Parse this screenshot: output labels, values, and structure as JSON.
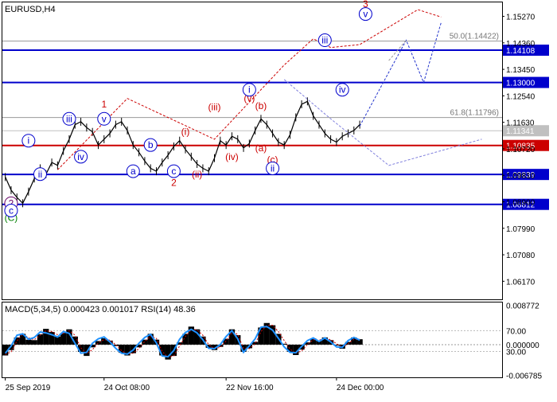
{
  "symbol": "EURUSD,H4",
  "chart_data": {
    "type": "candlestick",
    "main": {
      "ylim": [
        1.0555,
        1.1575
      ],
      "price_ticks": [
        "1.15270",
        "1.14360",
        "1.13450",
        "1.12540",
        "1.11630",
        "1.10720",
        "1.09810",
        "1.08900",
        "1.07990",
        "1.07080",
        "1.06170"
      ],
      "hlines": [
        {
          "value": 1.14108,
          "label": "1.14108",
          "color": "#0000cc"
        },
        {
          "value": 1.13,
          "label": "1.13000",
          "color": "#0000cc"
        },
        {
          "value": 1.10835,
          "label": "1.10835",
          "color": "#cc0000"
        },
        {
          "value": 1.09839,
          "label": "1.09839",
          "color": "#0000cc"
        },
        {
          "value": 1.08812,
          "label": "1.08812",
          "color": "#0000cc"
        }
      ],
      "current_price": "1.11341",
      "fib_levels": [
        {
          "value": 1.14422,
          "text": "50.0(1.14422)"
        },
        {
          "value": 1.11796,
          "text": "61.8(1.11796)"
        }
      ],
      "price_path": [
        [
          0,
          1.0975
        ],
        [
          1,
          1.093
        ],
        [
          2,
          1.0905
        ],
        [
          3,
          1.0885
        ],
        [
          4,
          1.0925
        ],
        [
          5,
          1.097
        ],
        [
          6,
          1.1005
        ],
        [
          7,
          1.0985
        ],
        [
          8,
          1.1025
        ],
        [
          9,
          1.1015
        ],
        [
          10,
          1.1065
        ],
        [
          11,
          1.1105
        ],
        [
          12,
          1.1155
        ],
        [
          13,
          1.1165
        ],
        [
          14,
          1.1145
        ],
        [
          15,
          1.113
        ],
        [
          16,
          1.1085
        ],
        [
          17,
          1.1105
        ],
        [
          18,
          1.1125
        ],
        [
          19,
          1.1155
        ],
        [
          20,
          1.1165
        ],
        [
          21,
          1.1135
        ],
        [
          22,
          1.1085
        ],
        [
          23,
          1.106
        ],
        [
          24,
          1.103
        ],
        [
          25,
          1.1005
        ],
        [
          26,
          1.0995
        ],
        [
          27,
          1.1025
        ],
        [
          28,
          1.105
        ],
        [
          29,
          1.108
        ],
        [
          30,
          1.11
        ],
        [
          31,
          1.107
        ],
        [
          32,
          1.1045
        ],
        [
          33,
          1.102
        ],
        [
          34,
          1.1005
        ],
        [
          35,
          1.0995
        ],
        [
          36,
          1.104
        ],
        [
          37,
          1.11
        ],
        [
          38,
          1.1085
        ],
        [
          39,
          1.1115
        ],
        [
          40,
          1.1105
        ],
        [
          41,
          1.1075
        ],
        [
          42,
          1.109
        ],
        [
          43,
          1.1135
        ],
        [
          44,
          1.1175
        ],
        [
          45,
          1.1155
        ],
        [
          46,
          1.1125
        ],
        [
          47,
          1.1095
        ],
        [
          48,
          1.1085
        ],
        [
          49,
          1.112
        ],
        [
          50,
          1.118
        ],
        [
          51,
          1.1225
        ],
        [
          52,
          1.1235
        ],
        [
          53,
          1.1185
        ],
        [
          54,
          1.1155
        ],
        [
          55,
          1.1125
        ],
        [
          56,
          1.1105
        ],
        [
          57,
          1.1095
        ],
        [
          58,
          1.1115
        ],
        [
          59,
          1.1125
        ],
        [
          60,
          1.1135
        ],
        [
          61,
          1.1155
        ]
      ],
      "zigzags": [
        {
          "color": "#cc0000",
          "points": [
            [
              9,
              1.1
            ],
            [
              21,
              1.1245
            ],
            [
              36,
              1.1105
            ],
            [
              48,
              1.136
            ],
            [
              53,
              1.145
            ],
            [
              56,
              1.142
            ],
            [
              61,
              1.143
            ],
            [
              71,
              1.155
            ],
            [
              75,
              1.1525
            ]
          ]
        },
        {
          "color": "#2233cc",
          "points": [
            [
              61,
              1.115
            ],
            [
              66,
              1.1335
            ],
            [
              69,
              1.1445
            ],
            [
              72,
              1.13
            ],
            [
              75,
              1.1505
            ]
          ]
        },
        {
          "color": "#999999",
          "points": [
            [
              66,
              1.1375
            ],
            [
              69,
              1.1445
            ]
          ]
        },
        {
          "color": "#7f7fdd",
          "points": [
            [
              48,
              1.131
            ],
            [
              56,
              1.1175
            ],
            [
              66,
              1.1015
            ],
            [
              82,
              1.1105
            ]
          ]
        }
      ],
      "wave_labels": [
        {
          "text": "(C)",
          "bar": 1,
          "value": 1.0835,
          "style": "paren",
          "color": "#008000"
        },
        {
          "text": "2",
          "bar": 1,
          "value": 1.0885,
          "style": "circle",
          "color": "#660066"
        },
        {
          "text": "c",
          "bar": 1,
          "value": 1.086,
          "style": "circle",
          "color": "#0000cc"
        },
        {
          "text": "i",
          "bar": 4,
          "value": 1.11,
          "style": "circle",
          "color": "#0000cc"
        },
        {
          "text": "ii",
          "bar": 6,
          "value": 1.0985,
          "style": "circle",
          "color": "#0000cc"
        },
        {
          "text": "iii",
          "bar": 11,
          "value": 1.1175,
          "style": "circle",
          "color": "#0000cc"
        },
        {
          "text": "iv",
          "bar": 13,
          "value": 1.1045,
          "style": "circle",
          "color": "#0000cc"
        },
        {
          "text": "v",
          "bar": 17,
          "value": 1.1175,
          "style": "circle",
          "color": "#0000cc"
        },
        {
          "text": "1",
          "bar": 17,
          "value": 1.1225,
          "style": "plain",
          "color": "#cc0000"
        },
        {
          "text": "a",
          "bar": 22,
          "value": 1.0995,
          "style": "circle",
          "color": "#0000cc"
        },
        {
          "text": "b",
          "bar": 25,
          "value": 1.1085,
          "style": "circle",
          "color": "#0000cc"
        },
        {
          "text": "c",
          "bar": 29,
          "value": 1.0995,
          "style": "circle",
          "color": "#0000cc"
        },
        {
          "text": "2",
          "bar": 29,
          "value": 1.0955,
          "style": "plain",
          "color": "#cc0000"
        },
        {
          "text": "(i)",
          "bar": 31,
          "value": 1.113,
          "style": "paren",
          "color": "#cc0000"
        },
        {
          "text": "(ii)",
          "bar": 33,
          "value": 1.0985,
          "style": "paren",
          "color": "#cc0000"
        },
        {
          "text": "(iii)",
          "bar": 36,
          "value": 1.1215,
          "style": "paren",
          "color": "#cc0000"
        },
        {
          "text": "(iv)",
          "bar": 39,
          "value": 1.1045,
          "style": "paren",
          "color": "#cc0000"
        },
        {
          "text": "(v)",
          "bar": 42,
          "value": 1.1245,
          "style": "paren",
          "color": "#cc0000"
        },
        {
          "text": "i",
          "bar": 42,
          "value": 1.1275,
          "style": "circle",
          "color": "#0000cc"
        },
        {
          "text": "(b)",
          "bar": 44,
          "value": 1.122,
          "style": "paren",
          "color": "#cc0000"
        },
        {
          "text": "(a)",
          "bar": 44,
          "value": 1.1075,
          "style": "paren",
          "color": "#cc0000"
        },
        {
          "text": "(c)",
          "bar": 46,
          "value": 1.1035,
          "style": "paren",
          "color": "#cc0000"
        },
        {
          "text": "ii",
          "bar": 46,
          "value": 1.1005,
          "style": "circle",
          "color": "#0000cc"
        },
        {
          "text": "iii",
          "bar": 55,
          "value": 1.1445,
          "style": "circle",
          "color": "#0000cc"
        },
        {
          "text": "iv",
          "bar": 58,
          "value": 1.1275,
          "style": "circle",
          "color": "#0000cc"
        },
        {
          "text": "v",
          "bar": 62,
          "value": 1.1535,
          "style": "circle",
          "color": "#0000cc"
        },
        {
          "text": "3",
          "bar": 62,
          "value": 1.157,
          "style": "plain",
          "color": "#cc0000"
        }
      ]
    },
    "indicator": {
      "title": "MACD(5,34,5) 0.000423 0.001017 RSI(14) 48.36",
      "ylim": [
        -0.00725,
        0.00935
      ],
      "y_ticks": [
        "0.008772",
        "0.000000",
        "-0.006785"
      ],
      "rsi_levels": [
        "70.00",
        "30.00"
      ],
      "rsi_level_values": [
        0.0031,
        -0.0015
      ],
      "histogram": [
        -0.0024,
        -0.0012,
        0.0016,
        0.0024,
        0.0011,
        0.001,
        0.0023,
        0.0035,
        0.0028,
        0.0018,
        0.0026,
        0.0034,
        0.0018,
        -0.0016,
        -0.0025,
        -0.0006,
        0.0008,
        0.0014,
        0.0009,
        -0.0003,
        -0.0018,
        -0.0024,
        -0.0019,
        -0.0006,
        0.0011,
        0.0024,
        0.0011,
        -0.0024,
        -0.0033,
        -0.0025,
        0.0005,
        0.0024,
        0.004,
        0.0034,
        0.0018,
        -0.0007,
        -0.0012,
        -0.0005,
        0.0013,
        0.0034,
        0.0021,
        -0.0016,
        -0.0008,
        0.0006,
        0.0038,
        0.0048,
        0.0043,
        0.0024,
        0.0002,
        -0.0016,
        -0.0023,
        -0.0011,
        0.0005,
        0.0014,
        0.0009,
        0.0016,
        0.001,
        -0.0002,
        -0.0009,
        0.0006,
        0.0016,
        0.0012
      ],
      "signal": [
        -0.0022,
        -0.0016,
        0.0008,
        0.0024,
        0.0015,
        0.0011,
        0.0021,
        0.0031,
        0.0029,
        0.0022,
        0.0025,
        0.0031,
        0.0021,
        -0.0007,
        -0.002,
        -0.0011,
        0.0004,
        0.0011,
        0.001,
        0.0,
        -0.0013,
        -0.0021,
        -0.0019,
        -0.0009,
        0.0007,
        0.0019,
        0.0014,
        -0.0015,
        -0.0028,
        -0.0025,
        -0.0003,
        0.0018,
        0.0033,
        0.0033,
        0.0021,
        0.0,
        -0.0009,
        -0.0006,
        0.0008,
        0.0027,
        0.0023,
        -0.0008,
        -0.0009,
        0.0002,
        0.0029,
        0.0043,
        0.0043,
        0.0029,
        0.0009,
        -0.001,
        -0.0019,
        -0.0014,
        0.0,
        0.0011,
        0.001,
        0.0014,
        0.0011,
        0.0002,
        -0.0006,
        0.0002,
        0.0012,
        0.0012
      ],
      "rsi_line": [
        -0.0019,
        -0.0003,
        0.0021,
        0.0024,
        0.0012,
        0.0016,
        0.0028,
        0.0026,
        0.0022,
        0.0017,
        0.0029,
        0.0025,
        0.0003,
        -0.0019,
        -0.0017,
        0.0003,
        0.0013,
        0.0017,
        0.0006,
        -0.0008,
        -0.0019,
        -0.0021,
        -0.0012,
        0.0003,
        0.0016,
        0.0023,
        0.0004,
        -0.0025,
        -0.0027,
        -0.0013,
        0.0012,
        0.0027,
        0.0034,
        0.0026,
        0.0011,
        -0.0008,
        -0.0009,
        0.0,
        0.0018,
        0.0031,
        0.0013,
        -0.0017,
        -0.0003,
        0.0013,
        0.0039,
        0.004,
        0.0032,
        0.0014,
        -0.0005,
        -0.0017,
        -0.0018,
        -0.0004,
        0.0009,
        0.0015,
        0.0007,
        0.0015,
        0.0006,
        -0.0005,
        -0.0006,
        0.0009,
        0.0016,
        0.001
      ]
    },
    "x_ticks": [
      {
        "label": "25 Sep 2019",
        "bar": 0
      },
      {
        "label": "24 Oct 08:00",
        "bar": 17
      },
      {
        "label": "22 Nov 16:00",
        "bar": 38
      },
      {
        "label": "24 Dec 00:00",
        "bar": 57
      }
    ],
    "bar_count": 86
  }
}
